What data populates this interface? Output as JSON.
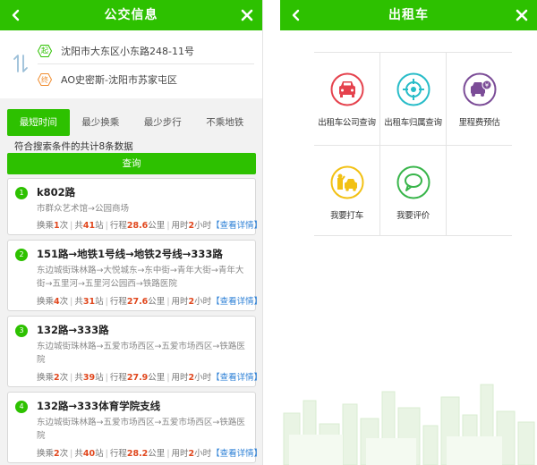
{
  "bus": {
    "title": "公交信息",
    "from": {
      "badge": "起",
      "text": "沈阳市大东区小东路248-11号"
    },
    "to": {
      "badge": "终",
      "text": "AO史密斯-沈阳市苏家屯区"
    },
    "tabs": [
      {
        "label": "最短时间",
        "active": true
      },
      {
        "label": "最少换乘",
        "active": false
      },
      {
        "label": "最少步行",
        "active": false
      },
      {
        "label": "不乘地铁",
        "active": false
      }
    ],
    "summary": "符合搜索条件的共计8条数据",
    "query_label": "查询",
    "routes": [
      {
        "num": "1",
        "title": "k802路",
        "path": "市群众艺术馆→公园商场",
        "transfer_label": "换乘",
        "transfers": "1",
        "transfer_unit": "次",
        "stops_label": "共",
        "stops": "41",
        "stops_unit": "站",
        "distance_label": "行程",
        "distance": "28.6",
        "distance_unit": "公里",
        "time_label": "用时",
        "time": "2",
        "time_unit": "小时",
        "detail": "【查看详情】"
      },
      {
        "num": "2",
        "title": "151路→地铁1号线→地铁2号线→333路",
        "path": "东边城街珠林路→大悦城东→东中街→青年大街→青年大街→五里河→五里河公园西→铁路医院",
        "transfer_label": "换乘",
        "transfers": "4",
        "transfer_unit": "次",
        "stops_label": "共",
        "stops": "31",
        "stops_unit": "站",
        "distance_label": "行程",
        "distance": "27.6",
        "distance_unit": "公里",
        "time_label": "用时",
        "time": "2",
        "time_unit": "小时",
        "detail": "【查看详情】"
      },
      {
        "num": "3",
        "title": "132路→333路",
        "path": "东边城街珠林路→五爱市场西区→五爱市场西区→铁路医院",
        "transfer_label": "换乘",
        "transfers": "2",
        "transfer_unit": "次",
        "stops_label": "共",
        "stops": "39",
        "stops_unit": "站",
        "distance_label": "行程",
        "distance": "27.9",
        "distance_unit": "公里",
        "time_label": "用时",
        "time": "2",
        "time_unit": "小时",
        "detail": "【查看详情】"
      },
      {
        "num": "4",
        "title": "132路→333体育学院支线",
        "path": "东边城街珠林路→五爱市场西区→五爱市场西区→铁路医院",
        "transfer_label": "换乘",
        "transfers": "2",
        "transfer_unit": "次",
        "stops_label": "共",
        "stops": "40",
        "stops_unit": "站",
        "distance_label": "行程",
        "distance": "28.2",
        "distance_unit": "公里",
        "time_label": "用时",
        "time": "2",
        "time_unit": "小时",
        "detail": "【查看详情】"
      }
    ]
  },
  "taxi": {
    "title": "出租车",
    "items": [
      {
        "label": "出租车公司查询",
        "icon": "taxi-front-icon",
        "color": "#e5424d"
      },
      {
        "label": "出租车归属查询",
        "icon": "crosshair-icon",
        "color": "#27bcc8"
      },
      {
        "label": "里程费预估",
        "icon": "fare-estimate-icon",
        "color": "#7b4c97"
      },
      {
        "label": "我要打车",
        "icon": "hail-taxi-icon",
        "color": "#f2c114"
      },
      {
        "label": "我要评价",
        "icon": "comment-bubble-icon",
        "color": "#38b54a"
      }
    ]
  },
  "colors": {
    "accent": "#2dc100",
    "highlight": "#e0461c",
    "link": "#2b7fd6"
  }
}
